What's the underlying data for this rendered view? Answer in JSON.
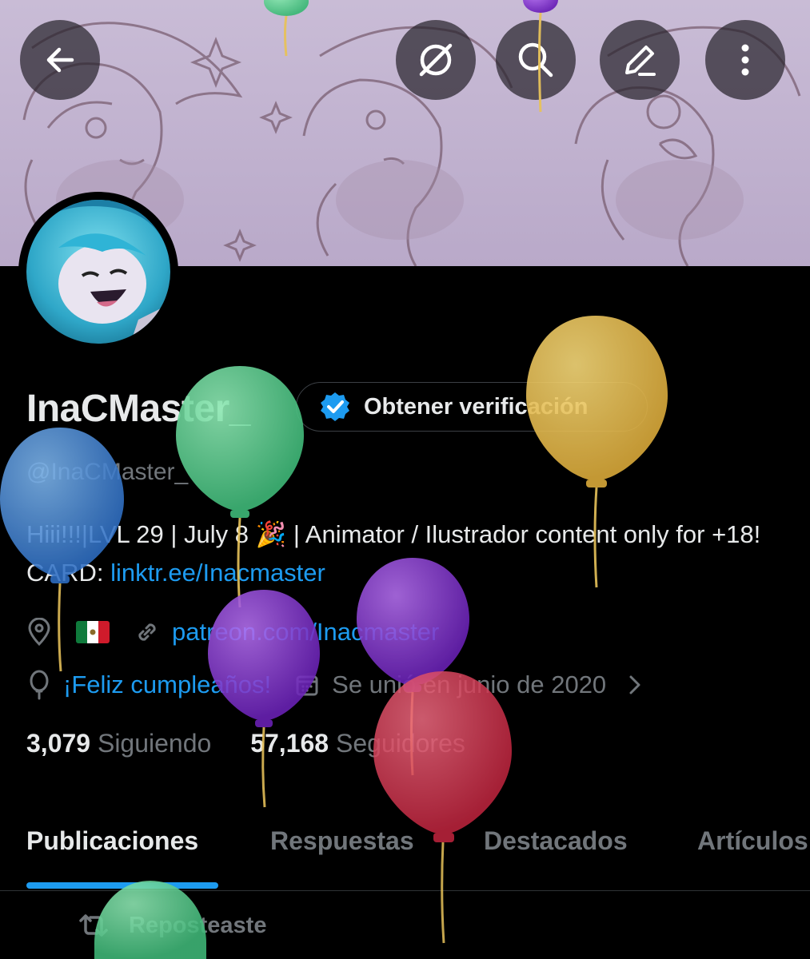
{
  "profile": {
    "display_name": "InaCMaster_",
    "handle": "@InaCMaster_",
    "verify_button_label": "Obtener verificación",
    "bio_text": "Hiii!!!|LVL 29 | July 8 🎉 | Animator / Ilustrador content only for +18!  CARD: ",
    "bio_link": "linktr.ee/Inacmaster",
    "website": "patreon.com/Inacmaster",
    "birthday_text": "¡Feliz cumpleaños!",
    "joined_text": "Se unió en junio de 2020",
    "following_count": "3,079",
    "following_label": "Siguiendo",
    "followers_count": "57,168",
    "followers_label": "Seguidores"
  },
  "tabs": [
    {
      "label": "Publicaciones",
      "active": true
    },
    {
      "label": "Respuestas",
      "active": false
    },
    {
      "label": "Destacados",
      "active": false
    },
    {
      "label": "Artículos",
      "active": false
    }
  ],
  "repost_label": "Reposteaste",
  "icons": {
    "back": "arrow-left-icon",
    "grok": "grok-icon",
    "search": "search-icon",
    "edit": "edit-icon",
    "more": "more-vertical-icon",
    "location": "location-pin-icon",
    "link": "link-icon",
    "birthday": "balloon-icon",
    "calendar": "calendar-icon",
    "repost": "repost-icon",
    "verified": "verified-badge-icon"
  },
  "colors": {
    "accent": "#1d9bf0",
    "text_primary": "#e7e9ea",
    "text_secondary": "#71767b",
    "background": "#000000"
  }
}
